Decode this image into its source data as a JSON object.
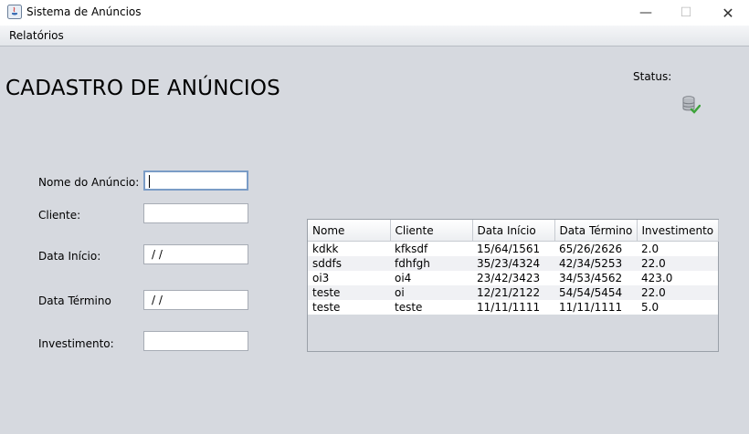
{
  "window": {
    "title": "Sistema de Anúncios",
    "minimize": "—",
    "maximize": "☐",
    "close": "✕"
  },
  "menu": {
    "items": [
      "Relatórios"
    ]
  },
  "page": {
    "title": "CADASTRO DE ANÚNCIOS"
  },
  "status": {
    "label": "Status:",
    "icon": "database-check-icon"
  },
  "form": {
    "nome_label": "Nome do Anúncio:",
    "nome_value": "",
    "cliente_label": "Cliente:",
    "cliente_value": "",
    "data_inicio_label": "Data Início:",
    "data_inicio_value": " /  /",
    "data_termino_label": "Data Término",
    "data_termino_value": " /  /",
    "investimento_label": "Investimento:",
    "investimento_value": ""
  },
  "table": {
    "columns": [
      "Nome",
      "Cliente",
      "Data Início",
      "Data Término",
      "Investimento"
    ],
    "rows": [
      [
        "kdkk",
        "kfksdf",
        "15/64/1561",
        "65/26/2626",
        "2.0"
      ],
      [
        "sddfs",
        "fdhfgh",
        "35/23/4324",
        "42/34/5253",
        "22.0"
      ],
      [
        "oi3",
        "oi4",
        "23/42/3423",
        "34/53/4562",
        "423.0"
      ],
      [
        "teste",
        "oi",
        "12/21/2122",
        "54/54/5454",
        "22.0"
      ],
      [
        "teste",
        "teste",
        "11/11/1111",
        "11/11/1111",
        "5.0"
      ]
    ]
  }
}
